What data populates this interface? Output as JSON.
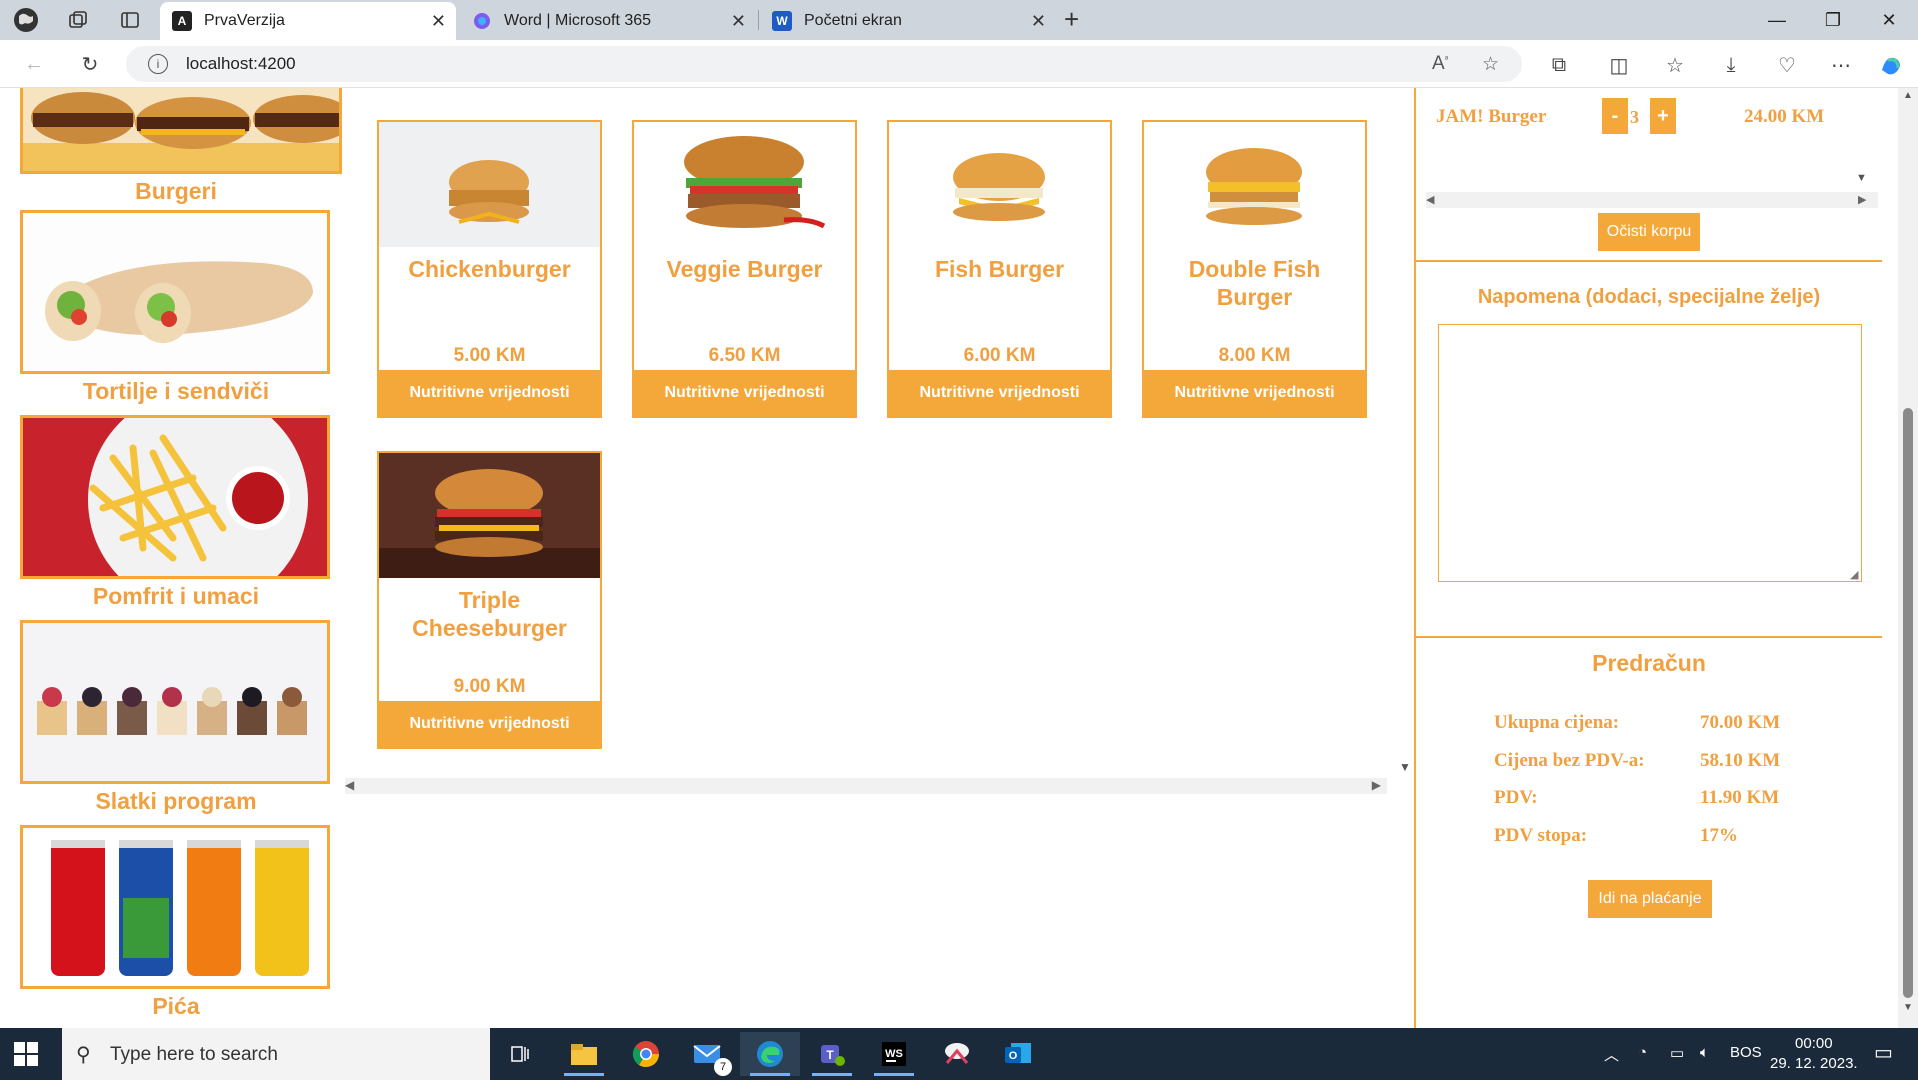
{
  "browser": {
    "tabs": [
      {
        "title": "PrvaVerzija",
        "active": true
      },
      {
        "title": "Word | Microsoft 365",
        "active": false
      },
      {
        "title": "Početni ekran",
        "active": false
      }
    ],
    "url": "localhost:4200"
  },
  "categories": [
    {
      "label": "Burgeri"
    },
    {
      "label": "Tortilje i sendviči"
    },
    {
      "label": "Pomfrit i umaci"
    },
    {
      "label": "Slatki program"
    },
    {
      "label": "Pića"
    }
  ],
  "products": [
    {
      "name": "Chickenburger",
      "price": "5.00 KM",
      "button": "Nutritivne vrijednosti"
    },
    {
      "name": "Veggie Burger",
      "price": "6.50 KM",
      "button": "Nutritivne vrijednosti"
    },
    {
      "name": "Fish Burger",
      "price": "6.00 KM",
      "button": "Nutritivne vrijednosti"
    },
    {
      "name": "Double Fish Burger",
      "price": "8.00 KM",
      "button": "Nutritivne vrijednosti"
    },
    {
      "name": "Triple Cheeseburger",
      "price": "9.00 KM",
      "button": "Nutritivne vrijednosti"
    }
  ],
  "cart": {
    "item": {
      "name": "JAM! Burger",
      "minus": "-",
      "qty": "3",
      "plus": "+",
      "price": "24.00 KM"
    },
    "clear_button": "Očisti korpu"
  },
  "note": {
    "title": "Napomena (dodaci, specijalne želje)",
    "value": ""
  },
  "bill": {
    "title": "Predračun",
    "rows": [
      {
        "label": "Ukupna cijena:",
        "value": "70.00 KM"
      },
      {
        "label": "Cijena bez PDV-a:",
        "value": "58.10 KM"
      },
      {
        "label": "PDV:",
        "value": "11.90 KM"
      },
      {
        "label": "PDV stopa:",
        "value": "17%"
      }
    ],
    "pay_button": "Idi na plaćanje"
  },
  "taskbar": {
    "search_placeholder": "Type here to search",
    "mail_badge": "7",
    "language": "BOS",
    "time": "00:00",
    "date": "29. 12. 2023."
  },
  "colors": {
    "accent": "#f5a83a"
  }
}
